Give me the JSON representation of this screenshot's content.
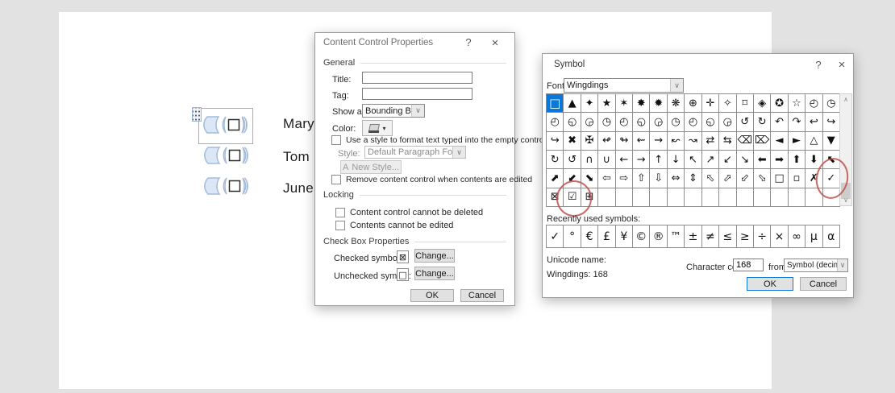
{
  "document": {
    "names": [
      "Mary",
      "Tom",
      "June"
    ],
    "checkbox_glyph": "□"
  },
  "properties_dialog": {
    "title": "Content Control Properties",
    "help_icon": "?",
    "close_icon": "×",
    "general": {
      "header": "General",
      "title_label": "Title:",
      "title_value": "",
      "tag_label": "Tag:",
      "tag_value": "",
      "show_as_label": "Show as:",
      "show_as_value": "Bounding Box",
      "color_label": "Color:",
      "use_style_label": "Use a style to format text typed into the empty control",
      "style_label": "Style:",
      "style_value": "Default Paragraph Font",
      "new_style_icon": "A",
      "new_style_label": "New Style...",
      "remove_label": "Remove content control when contents are edited"
    },
    "locking": {
      "header": "Locking",
      "cannot_delete_label": "Content control cannot be deleted",
      "cannot_edit_label": "Contents cannot be edited"
    },
    "checkbox_props": {
      "header": "Check Box Properties",
      "checked_label": "Checked symbol:",
      "checked_symbol": "⊠",
      "unchecked_label": "Unchecked symbol:",
      "unchecked_symbol": "□",
      "change_checked_label": "Change...",
      "change_unchecked_label": "Change..."
    },
    "ok_label": "OK",
    "cancel_label": "Cancel"
  },
  "symbol_dialog": {
    "title": "Symbol",
    "help_icon": "?",
    "close_icon": "×",
    "font_label": "Font:",
    "font_value": "Wingdings",
    "dropdown_arrow": "∨",
    "scroll_up_icon": "∧",
    "scroll_down_icon": "∨",
    "grid_rows": [
      [
        "□",
        "▲",
        "✦",
        "★",
        "✶",
        "✸",
        "✹",
        "❋",
        "⊕",
        "✛",
        "✧",
        "⌑",
        "◈",
        "✪",
        "☆",
        "◴",
        "◷"
      ],
      [
        "◴",
        "◵",
        "◶",
        "◷",
        "◴",
        "◵",
        "◶",
        "◷",
        "◴",
        "◵",
        "◶",
        "↺",
        "↻",
        "↶",
        "↷",
        "↩",
        "↪"
      ],
      [
        "↪",
        "✖",
        "✠",
        "↫",
        "↬",
        "⇜",
        "⇝",
        "↜",
        "↝",
        "⇄",
        "⇆",
        "⌫",
        "⌦",
        "◄",
        "►",
        "△",
        "▼"
      ],
      [
        "↻",
        "↺",
        "∩",
        "∪",
        "←",
        "→",
        "↑",
        "↓",
        "↖",
        "↗",
        "↙",
        "↘",
        "⬅",
        "➡",
        "⬆",
        "⬇",
        "⬉"
      ],
      [
        "⬈",
        "⬋",
        "⬊",
        "⇦",
        "⇨",
        "⇧",
        "⇩",
        "⇔",
        "⇕",
        "⬁",
        "⬀",
        "⬃",
        "⬂",
        "□",
        "▫",
        "✗",
        "✓"
      ],
      [
        "⊠",
        "☑",
        "⊞",
        "",
        "",
        "",
        "",
        "",
        "",
        "",
        "",
        "",
        "",
        "",
        "",
        "",
        ""
      ]
    ],
    "recent_label": "Recently used symbols:",
    "recent_symbols": [
      "✓",
      "°",
      "€",
      "£",
      "¥",
      "©",
      "®",
      "™",
      "±",
      "≠",
      "≤",
      "≥",
      "÷",
      "×",
      "∞",
      "µ",
      "α"
    ],
    "unicode_name_label": "Unicode name:",
    "unicode_name_value": "Wingdings: 168",
    "char_code_label": "Character code:",
    "char_code_value": "168",
    "from_label": "from:",
    "from_value": "Symbol (decimal)",
    "ok_label": "OK",
    "cancel_label": "Cancel"
  },
  "colors": {
    "selection_blue": "#0b77d6",
    "annotation_red": "#c0504d",
    "control_fill": "#dbe7f6",
    "control_stroke": "#a3bbd8"
  }
}
